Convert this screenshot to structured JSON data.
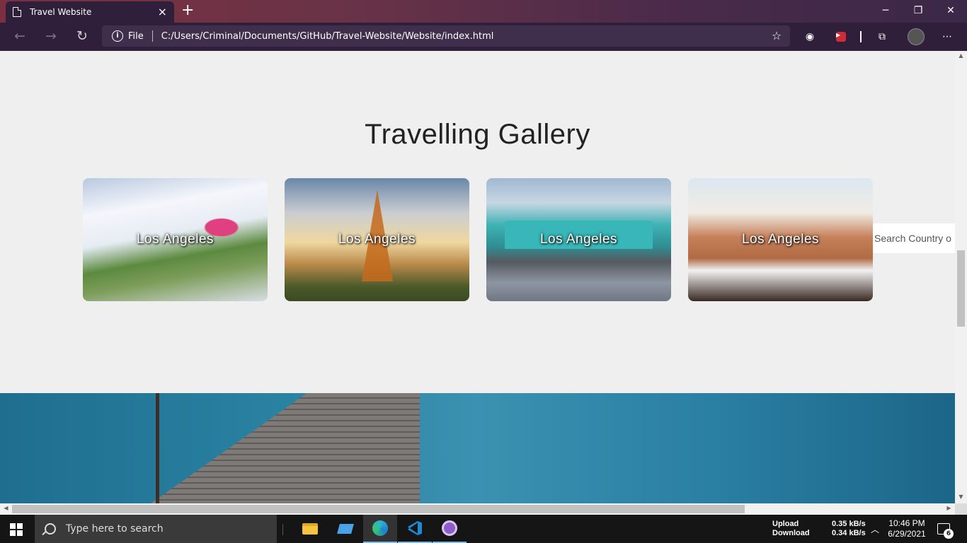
{
  "browser": {
    "tab_title": "Travel Website",
    "address_label": "File",
    "url": "C:/Users/Criminal/Documents/GitHub/Travel-Website/Website/index.html"
  },
  "page": {
    "gallery_title": "Travelling Gallery",
    "cards": [
      {
        "label": "Los Angeles"
      },
      {
        "label": "Los Angeles"
      },
      {
        "label": "Los Angeles"
      },
      {
        "label": "Los Angeles"
      }
    ],
    "search_placeholder": "Search Country o"
  },
  "taskbar": {
    "search_placeholder": "Type here to search",
    "net_upload_label": "Upload",
    "net_download_label": "Download",
    "net_upload_value": "0.35 kB/s",
    "net_download_value": "0.34 kB/s",
    "time": "10:46 PM",
    "date": "6/29/2021",
    "notification_count": "6"
  },
  "colors": {
    "browser_toolbar": "#2f1f3a",
    "page_background": "#efefef",
    "taskbar": "#151515"
  }
}
